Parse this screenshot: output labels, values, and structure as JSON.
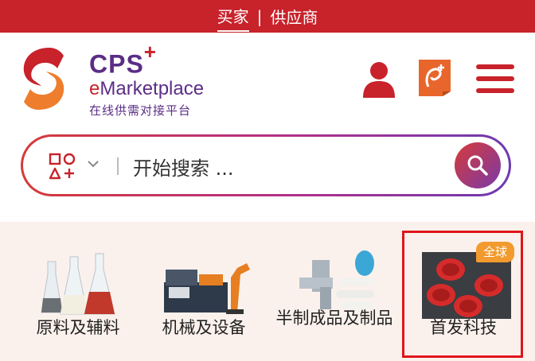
{
  "topbar": {
    "buyer": "买家",
    "separator": "|",
    "supplier": "供应商"
  },
  "brand": {
    "cps": "CPS",
    "plus": "+",
    "emp_e": "e",
    "emp_rest": "Marketplace",
    "tagline": "在线供需对接平台"
  },
  "search": {
    "placeholder": "开始搜索 ..."
  },
  "categories": [
    {
      "label": "原料及辅料"
    },
    {
      "label": "机械及设备"
    },
    {
      "label": "半制成品及制品"
    },
    {
      "label": "首发科技",
      "badge": "全球"
    }
  ],
  "colors": {
    "brand_red": "#c8222b",
    "brand_purple": "#5b2d86",
    "badge_orange": "#f29a2e"
  }
}
